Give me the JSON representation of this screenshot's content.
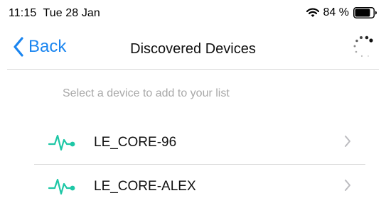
{
  "status_bar": {
    "time": "11:15",
    "date": "Tue 28 Jan",
    "battery_percent": "84 %",
    "wifi_icon": "wifi-icon",
    "battery_icon": "battery-icon",
    "battery_level": 0.84
  },
  "nav": {
    "back_label": "Back",
    "back_icon": "chevron-left-icon",
    "title": "Discovered Devices",
    "activity_icon": "spinner-icon",
    "accent_color": "#1a85f0"
  },
  "content": {
    "hint": "Select a device to add to your list",
    "devices": [
      {
        "name": "LE_CORE-96",
        "icon": "pulse-icon",
        "disclosure": "chevron-right-icon"
      },
      {
        "name": "LE_CORE-ALEX",
        "icon": "pulse-icon",
        "disclosure": "chevron-right-icon"
      }
    ],
    "icon_color": "#1ec7a6"
  }
}
